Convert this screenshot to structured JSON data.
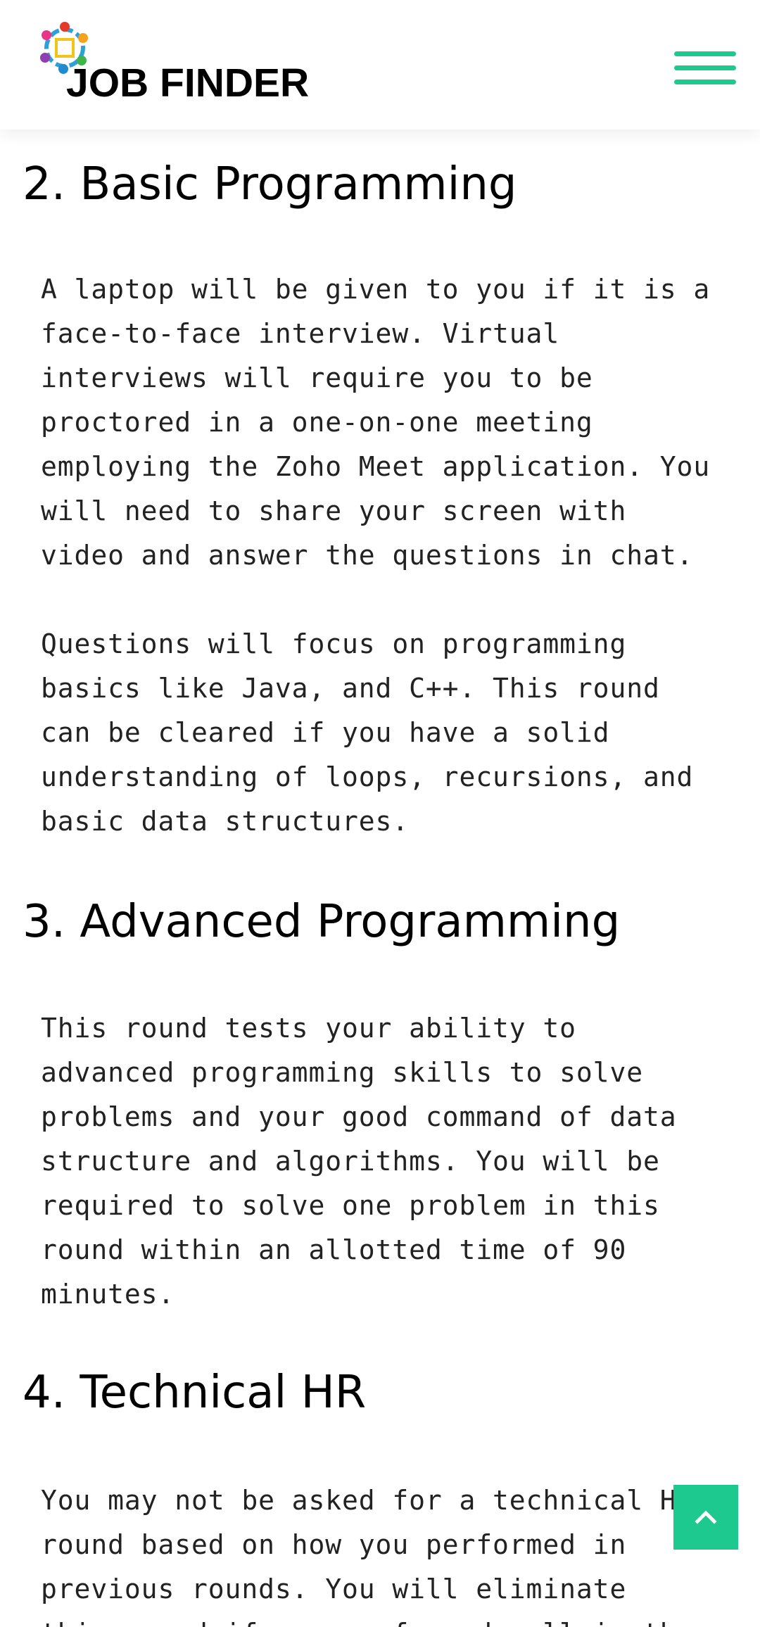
{
  "header": {
    "logo_text": "JOB FINDER",
    "menu_icon": "hamburger-menu-icon",
    "accent_color": "#1ec98f"
  },
  "sections": [
    {
      "title": "2. Basic Programming",
      "paragraphs": [
        "A laptop will be given to you if it is a\nface-to-face interview.  Virtual\ninterviews will require you to be\nproctored in a one-on-one meeting\nemploying the Zoho Meet application. You\nwill need to share your screen with\nvideo and answer the questions in chat.",
        "Questions will focus on programming\nbasics like Java, and C++. This round\ncan be cleared if you have a solid\nunderstanding of loops, recursions, and\nbasic data structures."
      ]
    },
    {
      "title": "3. Advanced Programming",
      "paragraphs": [
        "This round tests your ability to\nadvanced programming skills to solve\nproblems and your good command of data\nstructure and algorithms.  You will be\nrequired to solve one problem in this\nround within an allotted time of 90\nminutes."
      ]
    },
    {
      "title": "4. Technical HR",
      "paragraphs": [
        "You may not be asked for a technical HR\nround based on how you performed in\nprevious rounds.  You will eliminate\nthis round if you performed well in the"
      ]
    }
  ],
  "scroll_top": {
    "icon": "chevron-up-icon"
  }
}
